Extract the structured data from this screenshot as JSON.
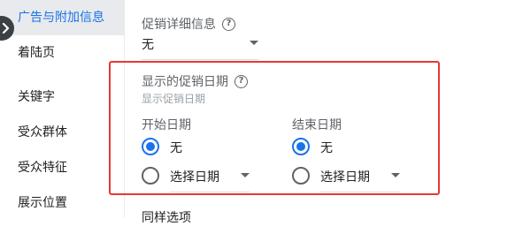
{
  "sidebar": {
    "items": [
      {
        "label": "广告与附加信息",
        "active": true
      },
      {
        "label": "着陆页"
      },
      {
        "label": "关键字"
      },
      {
        "label": "受众群体"
      },
      {
        "label": "受众特征"
      },
      {
        "label": "展示位置"
      }
    ]
  },
  "promo_details": {
    "label": "促销详细信息",
    "value": "无"
  },
  "displayed_promo_date": {
    "label": "显示的促销日期",
    "sublabel": "显示促销日期"
  },
  "start_date": {
    "label": "开始日期",
    "option_none": "无",
    "option_select": "选择日期"
  },
  "end_date": {
    "label": "结束日期",
    "option_none": "无",
    "option_select": "选择日期"
  },
  "next_section_partial": "同样选项",
  "colors": {
    "accent": "#1a73e8",
    "highlight": "#e53935",
    "sidebar_active_bg": "#e8eaed"
  }
}
